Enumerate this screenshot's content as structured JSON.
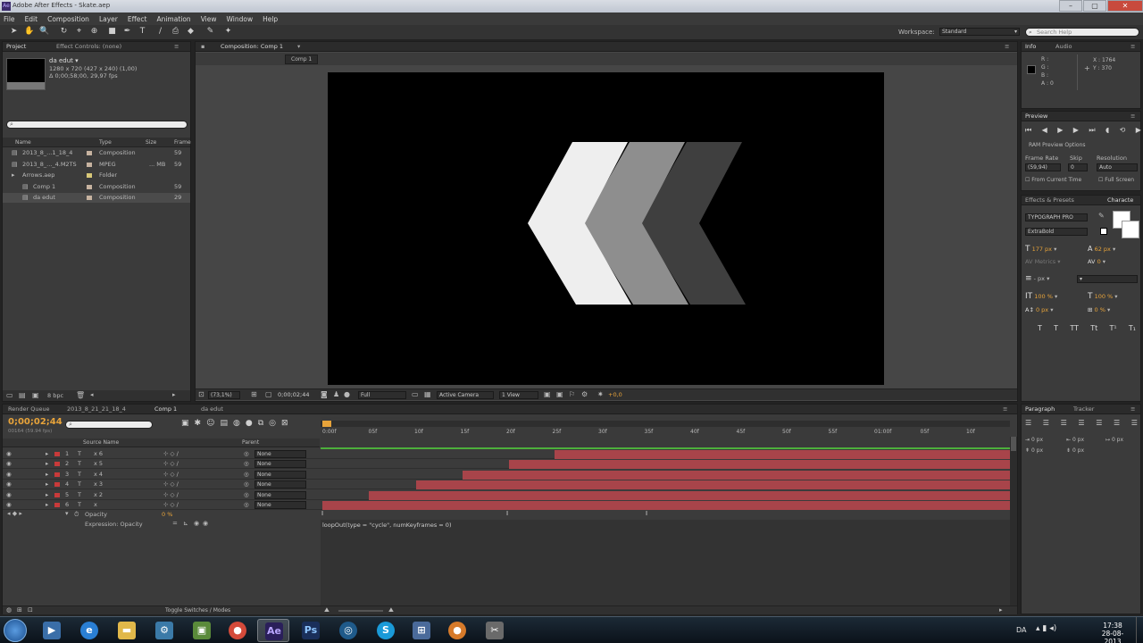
{
  "window": {
    "title": "Adobe After Effects - Skate.aep"
  },
  "menu": [
    "File",
    "Edit",
    "Composition",
    "Layer",
    "Effect",
    "Animation",
    "View",
    "Window",
    "Help"
  ],
  "toolbar": {
    "workspace_label": "Workspace:",
    "workspace_value": "Standard",
    "search_placeholder": "Search Help"
  },
  "project_panel": {
    "tabs": [
      "Project",
      "Effect Controls: (none)"
    ],
    "selected_name": "da edut ▾",
    "selected_info": [
      "1280 x 720  (427 x 240) (1,00)",
      "Δ 0;00;58;00, 29,97 fps"
    ],
    "columns": [
      "Name",
      "Type",
      "Size",
      "Frame"
    ],
    "items": [
      {
        "name": "2013_8_...1_18_4",
        "type": "Composition",
        "size": "",
        "frame": "59",
        "color": "#c7b3a0",
        "indent": 0
      },
      {
        "name": "2013_8_..._4.M2TS",
        "type": "MPEG",
        "size": "... MB",
        "frame": "59",
        "color": "#c7b3a0",
        "indent": 0
      },
      {
        "name": "Arrows.aep",
        "type": "Folder",
        "size": "",
        "frame": "",
        "color": "#d8c878",
        "indent": 0
      },
      {
        "name": "Comp 1",
        "type": "Composition",
        "size": "",
        "frame": "59",
        "color": "#c7b3a0",
        "indent": 1
      },
      {
        "name": "da edut",
        "type": "Composition",
        "size": "",
        "frame": "29",
        "color": "#c7b3a0",
        "indent": 1
      }
    ],
    "bpc": "8 bpc"
  },
  "comp_panel": {
    "tab": "Composition: Comp 1",
    "sub_tabs": [
      "Comp 1"
    ],
    "zoom": "(73,1%)",
    "timecode": "0;00;02;44",
    "resolution": "Full",
    "camera": "Active Camera",
    "view": "1 View",
    "exposure": "+0,0"
  },
  "info_panel": {
    "tabs": [
      "Info",
      "Audio"
    ],
    "lines": [
      "R :",
      "G :",
      "B :",
      "A : 0"
    ],
    "coords": [
      "X : 1764",
      "Y : 370"
    ]
  },
  "preview_panel": {
    "tab": "Preview",
    "ram_label": "RAM Preview Options",
    "labels": [
      "Frame Rate",
      "Skip",
      "Resolution"
    ],
    "values": [
      "(59,94)",
      "0",
      "Auto"
    ],
    "from_current": "From Current Time",
    "full_screen": "Full Screen"
  },
  "character_panel": {
    "tabs": [
      "Effects & Presets",
      "Characte"
    ],
    "font": "TYPOGRAPH PRO",
    "style": "ExtraBold",
    "size": "177 px",
    "leading": "62 px",
    "kerning": "Metrics",
    "tracking": "0",
    "stroke": "- px",
    "vscale": "100 %",
    "hscale": "100 %",
    "baseline": "0 px",
    "tsume": "0 %",
    "format_buttons": [
      "T",
      "T",
      "TT",
      "Tt",
      "T¹",
      "T₁"
    ]
  },
  "paragraph_panel": {
    "tabs": [
      "Paragraph",
      "Tracker"
    ],
    "rows": [
      [
        "0 px",
        "0 px",
        "0 px"
      ],
      [
        "0 px",
        "0 px"
      ]
    ]
  },
  "timeline": {
    "tabs": [
      "Render Queue",
      "2013_8_21_21_18_4",
      "Comp 1",
      "da edut"
    ],
    "timecode": "0;00;02;44",
    "fps": "00164 (59.94 fps)",
    "columns": [
      "Source Name",
      "Parent"
    ],
    "ruler": [
      "0:00f",
      "05f",
      "10f",
      "15f",
      "20f",
      "25f",
      "30f",
      "35f",
      "40f",
      "45f",
      "50f",
      "55f",
      "01:00f",
      "05f",
      "10f"
    ],
    "layers": [
      {
        "num": "1",
        "name": "x 6",
        "parent": "None",
        "start": 0.338
      },
      {
        "num": "2",
        "name": "x 5",
        "parent": "None",
        "start": 0.271
      },
      {
        "num": "3",
        "name": "x 4",
        "parent": "None",
        "start": 0.204
      },
      {
        "num": "4",
        "name": "x 3",
        "parent": "None",
        "start": 0.136
      },
      {
        "num": "5",
        "name": "x 2",
        "parent": "None",
        "start": 0.068
      },
      {
        "num": "6",
        "name": "x",
        "parent": "None",
        "start": 0.0
      }
    ],
    "opacity_label": "Opacity",
    "opacity_value": "0 %",
    "expression_label": "Expression: Opacity",
    "expression": "loopOut(type = \"cycle\", numKeyframes = 0)",
    "toggle": "Toggle Switches / Modes"
  },
  "taskbar": {
    "lang": "DA",
    "time": "17:38",
    "date": "28-08-2013"
  },
  "colors": {
    "accent": "#e7a33a",
    "layer_bar": "#a8444a",
    "bg": "#3b3b3b"
  }
}
